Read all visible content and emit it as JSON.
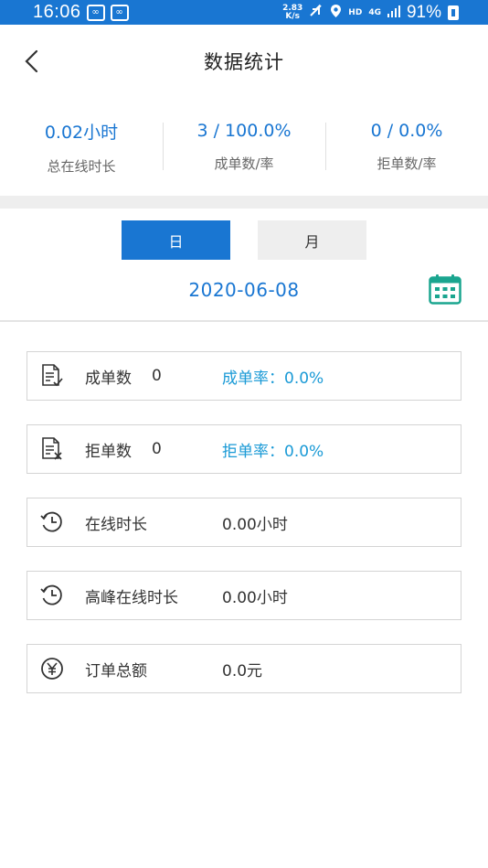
{
  "status_bar": {
    "time": "16:06",
    "net_speed_value": "2.83",
    "net_speed_unit": "K/s",
    "hd": "HD",
    "network": "4G",
    "battery": "91%"
  },
  "header": {
    "title": "数据统计"
  },
  "summary": [
    {
      "value": "0.02小时",
      "label": "总在线时长"
    },
    {
      "value": "3 / 100.0%",
      "label": "成单数/率"
    },
    {
      "value": "0 / 0.0%",
      "label": "拒单数/率"
    }
  ],
  "period_tabs": {
    "day": "日",
    "month": "月",
    "selected": "day"
  },
  "date": "2020-06-08",
  "cards": [
    {
      "icon": "completed-order-icon",
      "label": "成单数",
      "count": "0",
      "value": "成单率：0.0%"
    },
    {
      "icon": "rejected-order-icon",
      "label": "拒单数",
      "count": "0",
      "value": "拒单率：0.0%"
    },
    {
      "icon": "history-clock-icon",
      "label": "在线时长",
      "value": "0.00小时"
    },
    {
      "icon": "history-clock-icon",
      "label": "高峰在线时长",
      "value": "0.00小时"
    },
    {
      "icon": "yuan-coin-icon",
      "label": "订单总额",
      "value": "0.0元"
    }
  ],
  "colors": {
    "accent": "#1976d2",
    "rate_text": "#1a9ad6",
    "inactive_tab": "#eeeeee"
  }
}
